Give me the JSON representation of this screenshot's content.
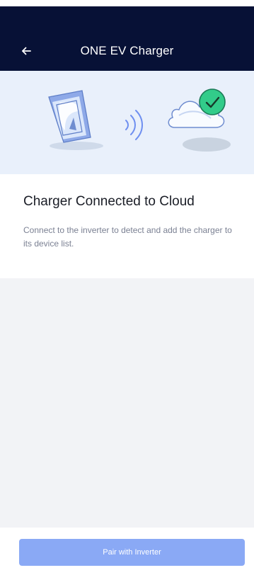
{
  "header": {
    "title": "ONE EV Charger",
    "back_icon": "arrow-left-icon"
  },
  "hero": {
    "illustration_icons": [
      "charger-icon",
      "wireless-signal-icon",
      "cloud-icon",
      "check-circle-icon"
    ],
    "check_color": "#32cc8a",
    "background_color": "#e9f0fb"
  },
  "status": {
    "title": "Charger Connected to Cloud",
    "description": "Connect to the inverter to detect and add the charger to its device list."
  },
  "footer": {
    "primary_button_label": "Pair with Inverter",
    "primary_button_color": "#8aa9f5"
  },
  "theme": {
    "header_color": "#071136",
    "page_background": "#f2f3f6"
  }
}
